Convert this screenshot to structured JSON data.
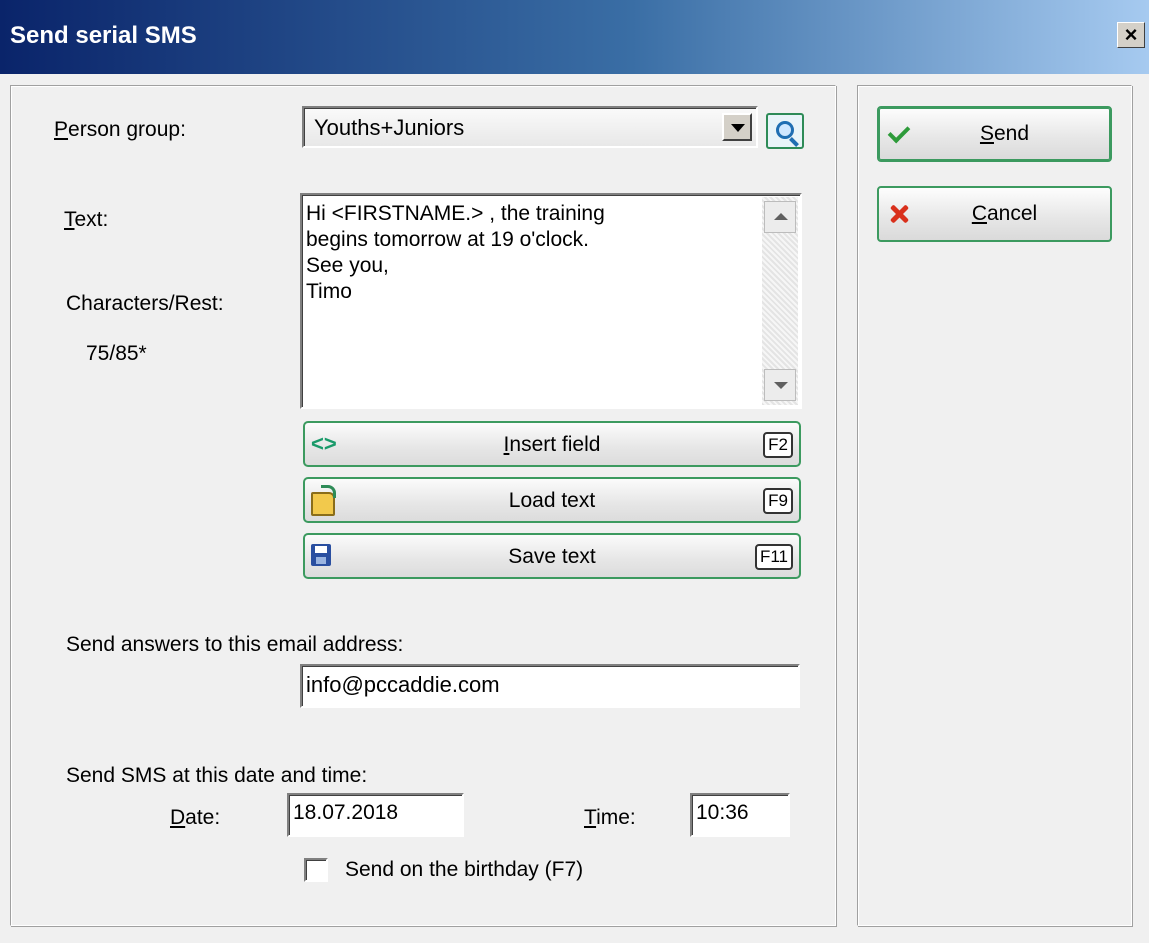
{
  "window": {
    "title": "Send serial SMS",
    "close_glyph": "×"
  },
  "person_group": {
    "label_key": "P",
    "label_rest": "erson group:",
    "selected": "Youths+Juniors"
  },
  "text_section": {
    "label_key": "T",
    "label_rest": "ext:",
    "counter_label": "Characters/Rest:",
    "counter_value": "75/85*",
    "message": "Hi <FIRSTNAME.> , the training\nbegins tomorrow at 19 o'clock.\nSee you,\nTimo"
  },
  "text_buttons": {
    "insert_field": {
      "label_key": "I",
      "label_rest": "nsert field",
      "fkey": "F2",
      "icon": "chevrons-icon",
      "icon_glyph": "<>"
    },
    "load_text": {
      "label": "Load text",
      "fkey": "F9",
      "icon": "folder-icon"
    },
    "save_text": {
      "label": "Save text",
      "fkey": "F11",
      "icon": "floppy-disk-icon"
    }
  },
  "email": {
    "label": "Send answers to this email address:",
    "value": "info@pccaddie.com"
  },
  "schedule": {
    "label": "Send SMS at this date and time:",
    "date_label_key": "D",
    "date_label_rest": "ate:",
    "date_value": "18.07.2018",
    "time_label_key": "T",
    "time_label_rest": "ime:",
    "time_value": "10:36",
    "birthday_label": "Send on the birthday (F7)",
    "birthday_checked": false
  },
  "actions": {
    "send_key": "S",
    "send_rest": "end",
    "cancel_key": "C",
    "cancel_rest": "ancel"
  },
  "colors": {
    "titlebar_start": "#0a246a",
    "titlebar_end": "#a6caf0",
    "button_border": "#3c9a5f",
    "send_check": "#2e9b3a",
    "cancel_x": "#d9301c"
  }
}
